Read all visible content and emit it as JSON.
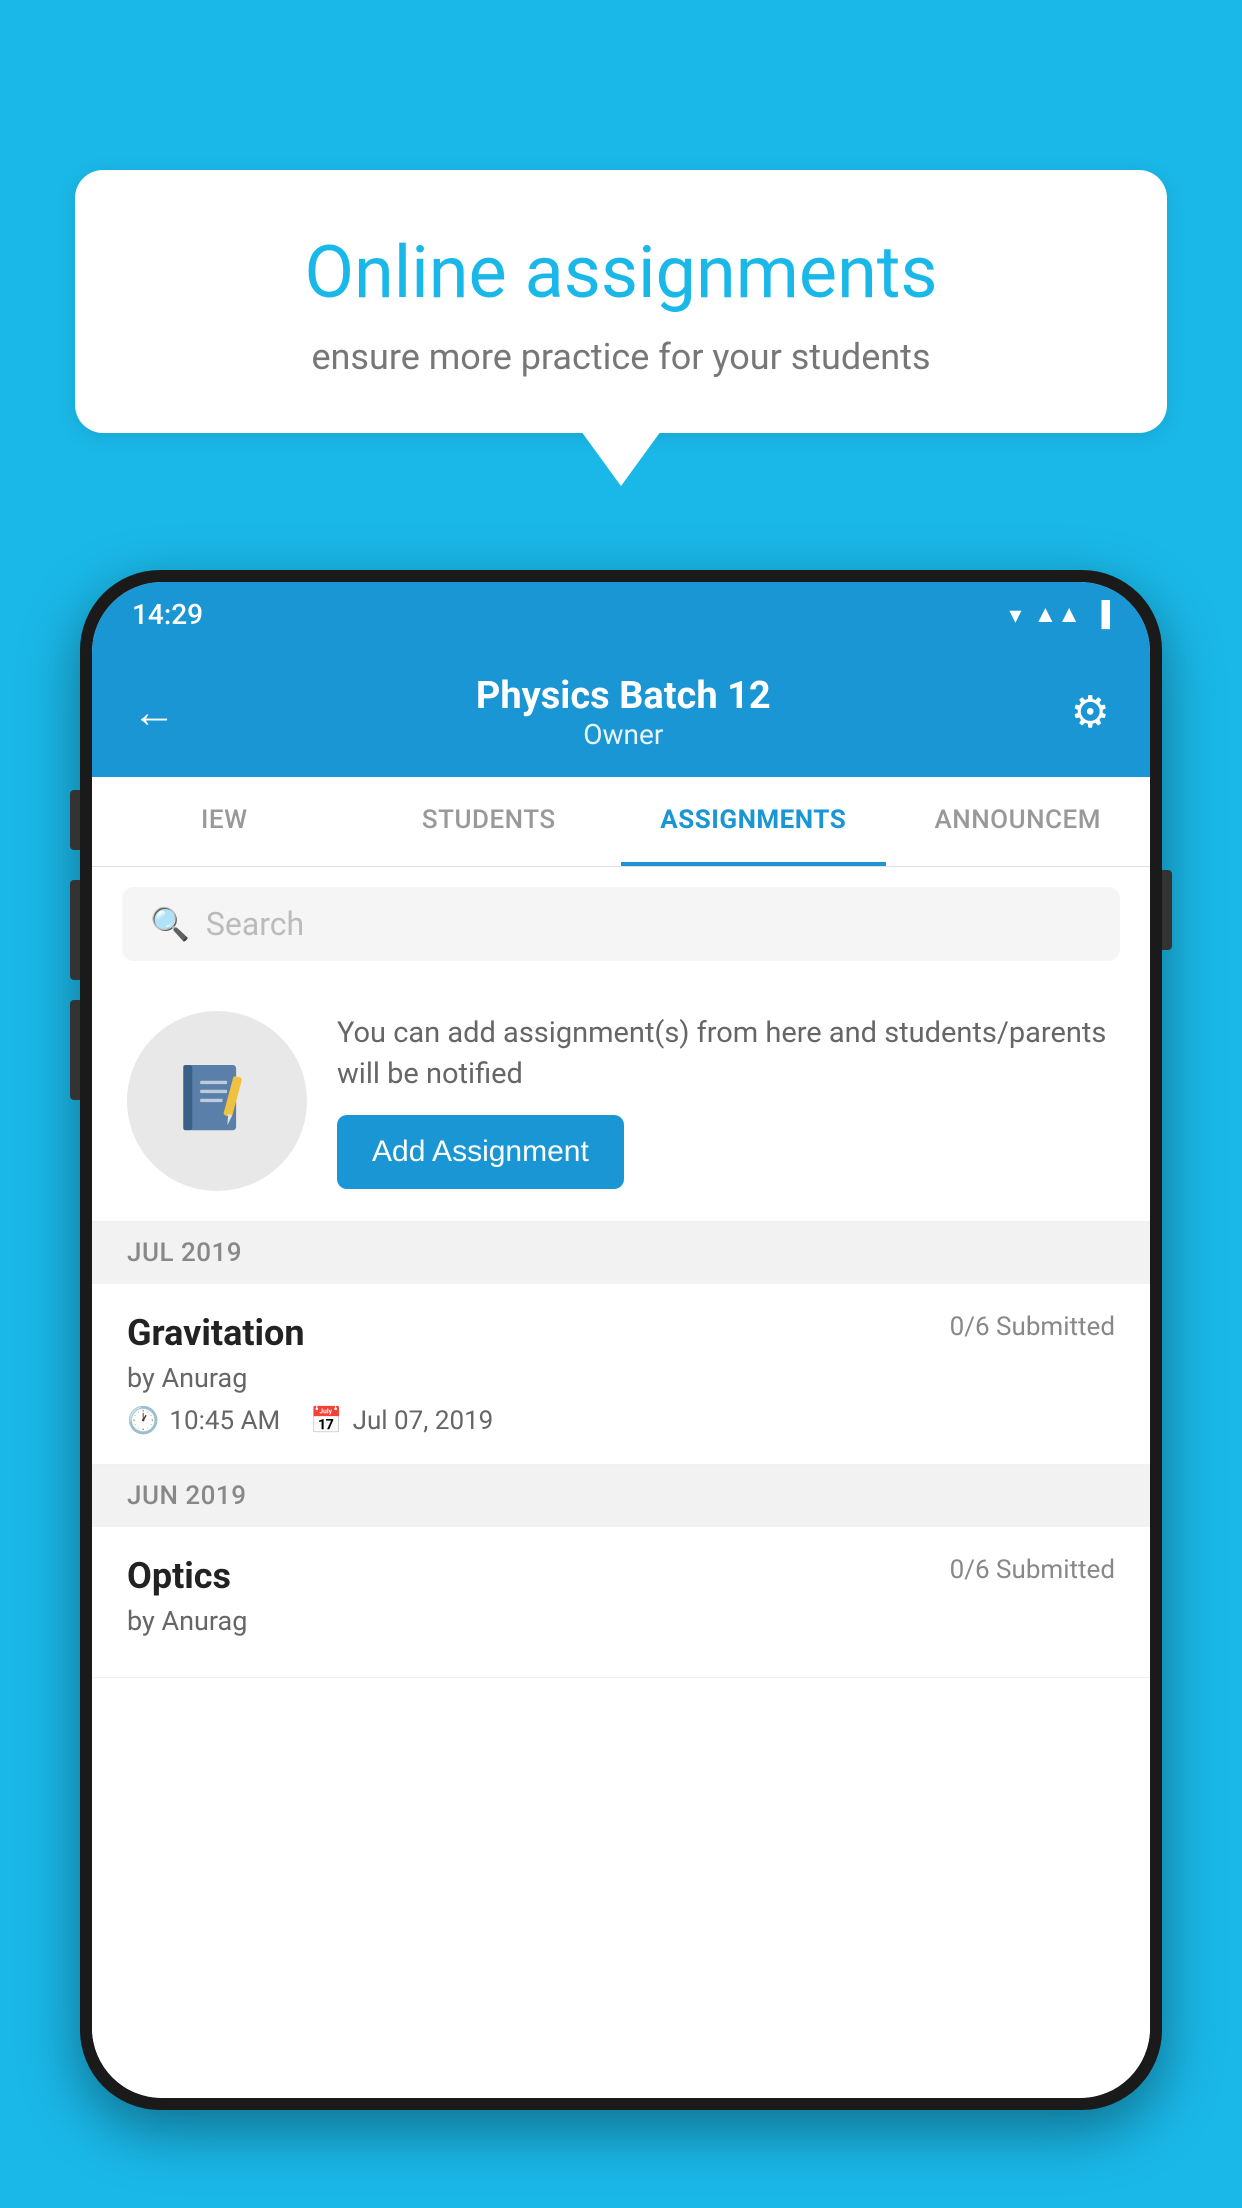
{
  "background_color": "#1ab8e8",
  "speech_bubble": {
    "title": "Online assignments",
    "subtitle": "ensure more practice for your students"
  },
  "phone": {
    "status_bar": {
      "time": "14:29",
      "wifi_icon": "wifi",
      "signal_icon": "signal",
      "battery_icon": "battery"
    },
    "header": {
      "title": "Physics Batch 12",
      "subtitle": "Owner",
      "back_label": "←",
      "settings_label": "⚙"
    },
    "tabs": [
      {
        "label": "IEW",
        "active": false
      },
      {
        "label": "STUDENTS",
        "active": false
      },
      {
        "label": "ASSIGNMENTS",
        "active": true
      },
      {
        "label": "ANNOUNCEM",
        "active": false
      }
    ],
    "search": {
      "placeholder": "Search"
    },
    "promo": {
      "description": "You can add assignment(s) from here and students/parents will be notified",
      "button_label": "Add Assignment"
    },
    "sections": [
      {
        "title": "JUL 2019",
        "assignments": [
          {
            "name": "Gravitation",
            "submitted": "0/6 Submitted",
            "author": "by Anurag",
            "time": "10:45 AM",
            "date": "Jul 07, 2019"
          }
        ]
      },
      {
        "title": "JUN 2019",
        "assignments": [
          {
            "name": "Optics",
            "submitted": "0/6 Submitted",
            "author": "by Anurag",
            "time": "",
            "date": ""
          }
        ]
      }
    ]
  }
}
